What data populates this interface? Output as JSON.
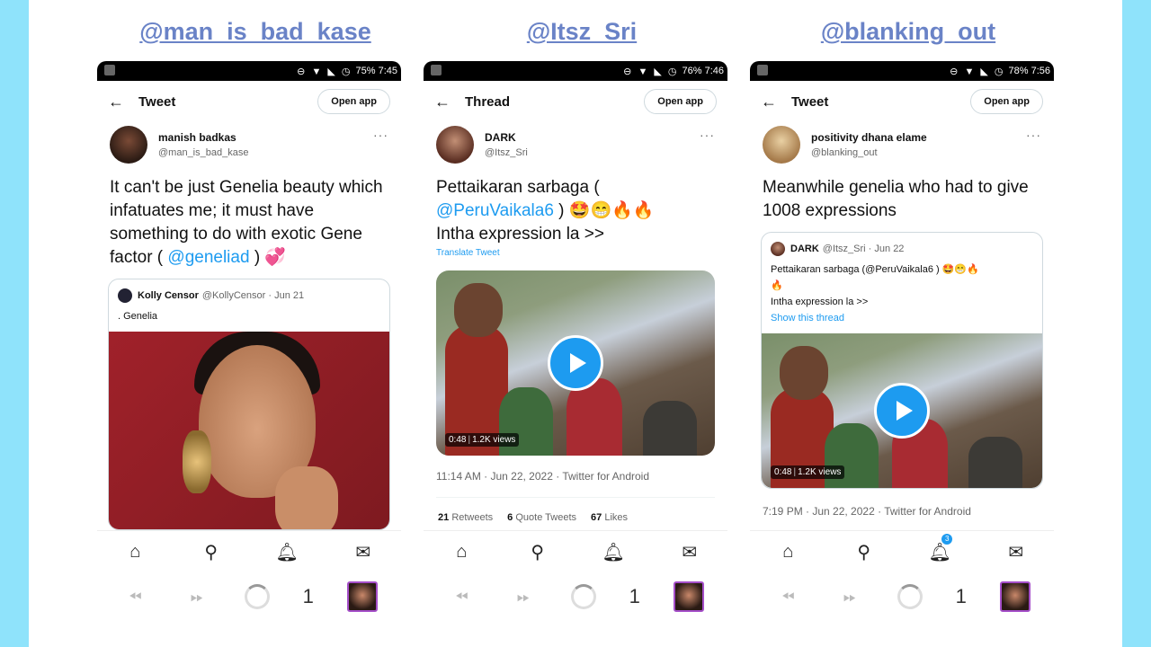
{
  "headers": [
    "@man_is_bad_kase",
    "@Itsz_Sri",
    "@blanking_out"
  ],
  "colors": {
    "side_bars": "#8fe3fb",
    "header_text": "#6a83c7",
    "link": "#1d9bf0"
  },
  "status_bar": {
    "phone1": "75% 7:45",
    "phone2": "76% 7:46",
    "phone3": "78% 7:56"
  },
  "phone1": {
    "topbar_title": "Tweet",
    "open_app": "Open app",
    "author_name": "manish badkas",
    "author_handle": "@man_is_bad_kase",
    "text_before": "It can't be just Genelia beauty which infatuates me; it must have something to do with exotic Gene factor ( ",
    "mention": "@geneliad",
    "text_after": " ) 💞",
    "quote": {
      "name": "Kolly Censor",
      "meta": "@KollyCensor · Jun 21",
      "text": ". Genelia"
    }
  },
  "phone2": {
    "topbar_title": "Thread",
    "open_app": "Open app",
    "author_name": "DARK",
    "author_handle": "@Itsz_Sri",
    "text_line1": "Pettaikaran sarbaga ( ",
    "mention": "@PeruVaikala6",
    "text_line1_end": " ) 🤩😁🔥🔥",
    "text_line2": "Intha expression la >>",
    "translate": "Translate Tweet",
    "video_time": "0:48",
    "video_views": "1.2K views",
    "timestamp": "11:14 AM · Jun 22, 2022 · Twitter for Android",
    "stats": {
      "retweets_n": "21",
      "retweets_l": "Retweets",
      "quotes_n": "6",
      "quotes_l": "Quote Tweets",
      "likes_n": "67",
      "likes_l": "Likes"
    }
  },
  "phone3": {
    "topbar_title": "Tweet",
    "open_app": "Open app",
    "author_name": "positivity dhana elame",
    "author_handle": "@blanking_out",
    "text": "Meanwhile genelia who had to give 1008 expressions",
    "quote": {
      "name": "DARK",
      "meta": "@Itsz_Sri · Jun 22",
      "line1": "Pettaikaran sarbaga (@PeruVaikala6 ) 🤩😁🔥",
      "line2": "🔥",
      "line3": "Intha expression la >>",
      "show_thread": "Show this thread",
      "video_time": "0:48",
      "video_views": "1.2K views"
    },
    "timestamp": "7:19 PM · Jun 22, 2022 · Twitter for Android",
    "notif_badge": "3"
  },
  "nav_icons": [
    "home-icon",
    "search-icon",
    "bell-icon",
    "mail-icon"
  ],
  "browser_bar": {
    "tab_count": "1"
  }
}
